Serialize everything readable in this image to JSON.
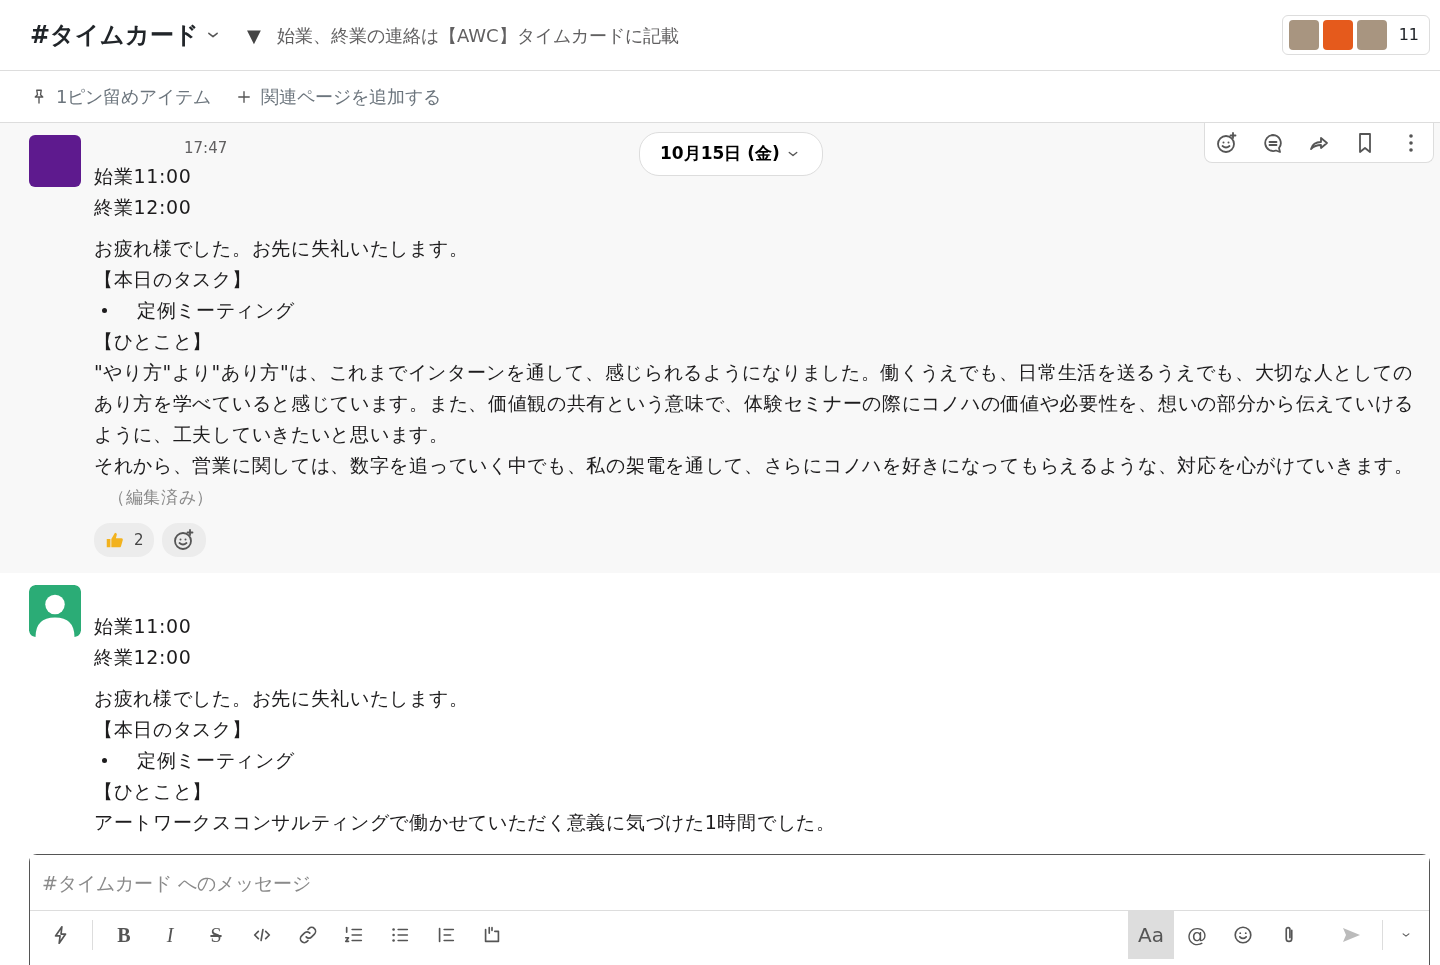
{
  "header": {
    "channel": "#タイムカード",
    "topic_toggle": "▼",
    "topic": "始業、終業の連絡は【AWC】タイムカードに記載",
    "member_count": "11"
  },
  "bookmarks": [
    {
      "kind": "pin",
      "label": "1ピン留めアイテム"
    },
    {
      "kind": "add",
      "label": "関連ページを追加する"
    }
  ],
  "date_divider": "10月15日 (金)",
  "messages": [
    {
      "avatar": {
        "kind": "block",
        "color": "#5e1a8e"
      },
      "time": "17:47",
      "hovered": true,
      "paragraphs": [
        [
          {
            "kind": "text",
            "text": "始業11:00"
          },
          {
            "kind": "text",
            "text": "終業12:00"
          }
        ],
        [
          {
            "kind": "text",
            "text": "お疲れ様でした。お先に失礼いたします。"
          },
          {
            "kind": "text",
            "text": "【本日のタスク】"
          },
          {
            "kind": "bullet",
            "text": "定例ミーティング"
          },
          {
            "kind": "text",
            "text": "【ひとこと】"
          },
          {
            "kind": "text",
            "text": "\"やり方\"より\"あり方\"は、これまでインターンを通して、感じられるようになりました。働くうえでも、日常生活を送るうえでも、大切な人としてのあり方を学べていると感じています。また、価値観の共有という意味で、体験セミナーの際にコノハの価値や必要性を、想いの部分から伝えていけるように、工夫していきたいと思います。"
          },
          {
            "kind": "text",
            "text": "それから、営業に関しては、数字を追っていく中でも、私の架電を通して、さらにコノハを好きになってもらえるような、対応を心がけていきます。",
            "edited": "（編集済み）"
          }
        ]
      ],
      "reactions": [
        {
          "kind": "thumbs-up",
          "count": "2"
        },
        {
          "kind": "add"
        }
      ]
    },
    {
      "avatar": {
        "kind": "person",
        "color": "#2bac76"
      },
      "hovered": false,
      "paragraphs": [
        [
          {
            "kind": "text",
            "text": "始業11:00"
          },
          {
            "kind": "text",
            "text": "終業12:00"
          }
        ],
        [
          {
            "kind": "text",
            "text": "お疲れ様でした。お先に失礼いたします。"
          },
          {
            "kind": "text",
            "text": "【本日のタスク】"
          },
          {
            "kind": "bullet",
            "text": "定例ミーティング"
          },
          {
            "kind": "text",
            "text": "【ひとこと】"
          },
          {
            "kind": "text",
            "text": "アートワークスコンサルティングで働かせていただく意義に気づけた1時間でした。"
          }
        ]
      ]
    }
  ],
  "composer": {
    "placeholder": "#タイムカード へのメッセージ",
    "left_tools": [
      {
        "kind": "shortcut"
      },
      {
        "kind": "bold",
        "label": "B"
      },
      {
        "kind": "italic",
        "label": "I"
      },
      {
        "kind": "strike",
        "label": "S"
      },
      {
        "kind": "code"
      },
      {
        "kind": "link"
      },
      {
        "kind": "ordered"
      },
      {
        "kind": "bullets"
      },
      {
        "kind": "quote"
      },
      {
        "kind": "codeblock"
      }
    ],
    "right_tools": [
      {
        "kind": "format",
        "label": "Aa",
        "selected": true
      },
      {
        "kind": "mention",
        "label": "@"
      },
      {
        "kind": "emoji"
      },
      {
        "kind": "attach"
      }
    ],
    "send_disabled": true
  }
}
